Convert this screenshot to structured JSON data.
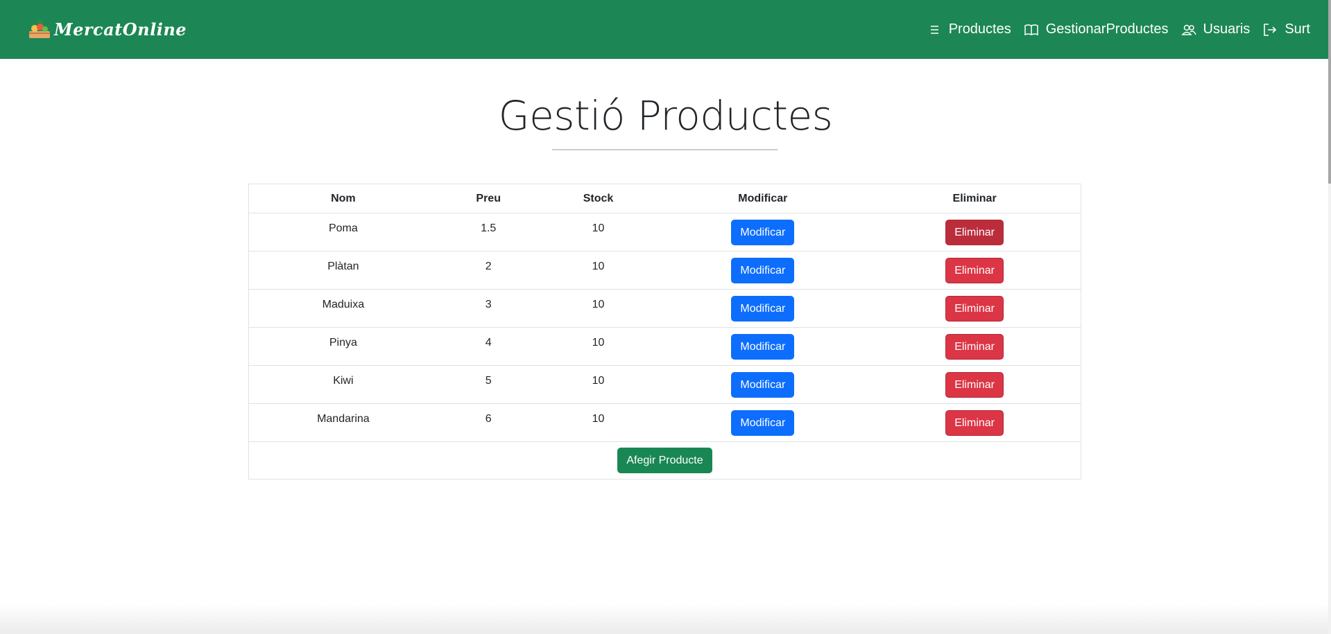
{
  "navbar": {
    "brand": "MercatOnline",
    "links": [
      {
        "label": "Productes",
        "icon": "list-icon"
      },
      {
        "label": "GestionarProductes",
        "icon": "book-icon"
      },
      {
        "label": "Usuaris",
        "icon": "users-icon"
      },
      {
        "label": "Surt",
        "icon": "logout-icon"
      }
    ]
  },
  "page": {
    "title": "Gestió Productes"
  },
  "table": {
    "headers": [
      "Nom",
      "Preu",
      "Stock",
      "Modificar",
      "Eliminar"
    ],
    "rows": [
      {
        "nom": "Poma",
        "preu": "1.5",
        "stock": "10"
      },
      {
        "nom": "Plàtan",
        "preu": "2",
        "stock": "10"
      },
      {
        "nom": "Maduixa",
        "preu": "3",
        "stock": "10"
      },
      {
        "nom": "Pinya",
        "preu": "4",
        "stock": "10"
      },
      {
        "nom": "Kiwi",
        "preu": "5",
        "stock": "10"
      },
      {
        "nom": "Mandarina",
        "preu": "6",
        "stock": "10"
      }
    ],
    "modify_label": "Modificar",
    "delete_label": "Eliminar",
    "add_label": "Afegir Producte"
  },
  "colors": {
    "navbar": "#1c8754",
    "primary": "#0d6efd",
    "danger": "#dc3545",
    "success": "#198754"
  }
}
